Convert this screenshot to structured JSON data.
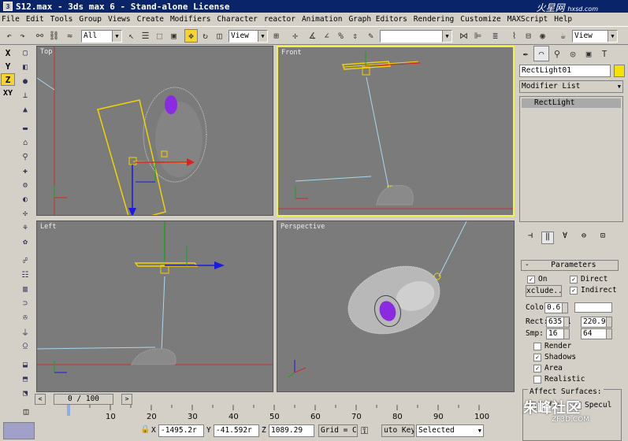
{
  "title": "S12.max - 3ds max 6 - Stand-alone License",
  "watermark_top": "火星网",
  "watermark_top_sub": "hxsd.com",
  "watermark_bottom": "朱峰社区",
  "watermark_bottom_sub": "ZF3D.COM",
  "menu": [
    "File",
    "Edit",
    "Tools",
    "Group",
    "Views",
    "Create",
    "Modifiers",
    "Character",
    "reactor",
    "Animation",
    "Graph Editors",
    "Rendering",
    "Customize",
    "MAXScript",
    "Help"
  ],
  "toolbar": {
    "selection_filter": "All",
    "ref_coord": "View",
    "named_sel": "",
    "view_combo": "View"
  },
  "axis_constraints": [
    "X",
    "Y",
    "Z",
    "XY"
  ],
  "active_axis": "Z",
  "viewports": {
    "top": "Top",
    "front": "Front",
    "left": "Left",
    "perspective": "Perspective"
  },
  "command_panel": {
    "object_name": "RectLight01",
    "modifier_list": "Modifier List",
    "stack_item": "RectLight",
    "rollout_title": "Parameters",
    "on_label": "On",
    "exclude_button": "xclude..",
    "direct_label": "Direct",
    "indirect_label": "Indirect",
    "color_label": "Color:",
    "color_value": "0.6",
    "rect_label": "Rect:",
    "rect_w": "635.1",
    "rect_h": "220.9",
    "smp_label": "Smp:",
    "smp_a": "16",
    "smp_b": "64",
    "render_label": "Render",
    "shadows_label": "Shadows",
    "area_label": "Area",
    "realistic_label": "Realistic",
    "affect_label": "Affect Surfaces:",
    "diffuse_label": "Diffu",
    "specular_label": "Specul"
  },
  "timeline": {
    "frame_display": "0 / 100",
    "ruler_ticks": [
      "10",
      "20",
      "30",
      "40",
      "50",
      "60",
      "70",
      "80",
      "90",
      "100"
    ]
  },
  "status": {
    "x_label": "X",
    "x_value": "-1495.2r",
    "y_label": "Y",
    "y_value": "-41.592r",
    "z_label": "Z",
    "z_value": "1089.29",
    "grid_label": "Grid = C",
    "autokey_label": "uto Key",
    "selected_combo": "Selected"
  },
  "colors": {
    "title_bar": "#0a246a",
    "viewport_bg": "#7b7b7b",
    "active_viewport_border": "#f2f249",
    "light_yellow": "#f2d200",
    "light_line": "#a8d8f0",
    "axis_blue": "#1a1ae0",
    "axis_red": "#e02020",
    "axis_green": "#1ea01e",
    "mesh_purple": "#8a2be2"
  }
}
